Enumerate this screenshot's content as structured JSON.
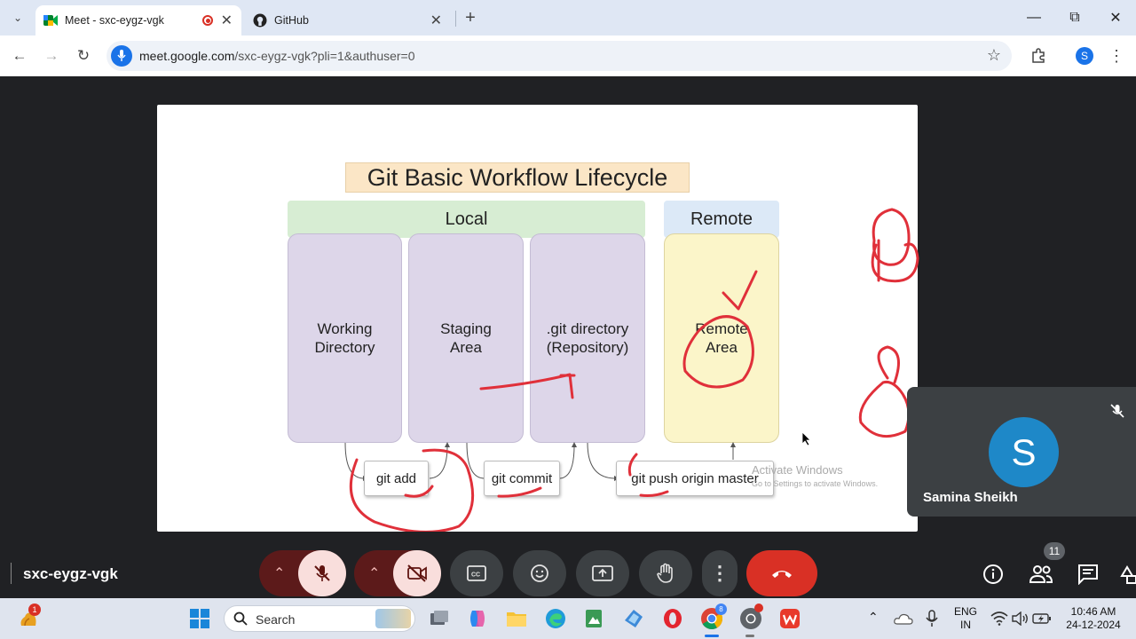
{
  "browser": {
    "tabs": [
      {
        "title": "Meet - sxc-eygz-vgk",
        "active": true
      },
      {
        "title": "GitHub",
        "active": false
      }
    ],
    "url_host": "meet.google.com",
    "url_path": "/sxc-eygz-vgk?pli=1&authuser=0",
    "profile_initial": "S"
  },
  "slide": {
    "title": "Git Basic Workflow Lifecycle",
    "local_header": "Local",
    "remote_header": "Remote",
    "working_directory": "Working Directory",
    "staging_area": "Staging Area",
    "git_directory": ".git directory (Repository)",
    "remote_area": "Remote Area",
    "cmd_add": "git add",
    "cmd_commit": "git commit",
    "cmd_push": "git push origin master",
    "watermark_title": "Activate Windows",
    "watermark_sub": "Go to Settings to activate Windows."
  },
  "participant": {
    "name": "Samina Sheikh",
    "initial": "S"
  },
  "meeting": {
    "code": "sxc-eygz-vgk",
    "participants_count": "11"
  },
  "taskbar": {
    "search_placeholder": "Search",
    "widget_badge": "1",
    "chrome_badge": "8",
    "language_line1": "ENG",
    "language_line2": "IN",
    "time": "10:46 AM",
    "date": "24-12-2024"
  },
  "colors": {
    "local_header": "#d7edd3",
    "remote_header": "#dce9f7",
    "local_box": "#ddd6e9",
    "remote_box": "#fbf5c9",
    "title_box": "#fbe6c6",
    "annotation": "#e0303a",
    "end_call": "#d93025"
  }
}
